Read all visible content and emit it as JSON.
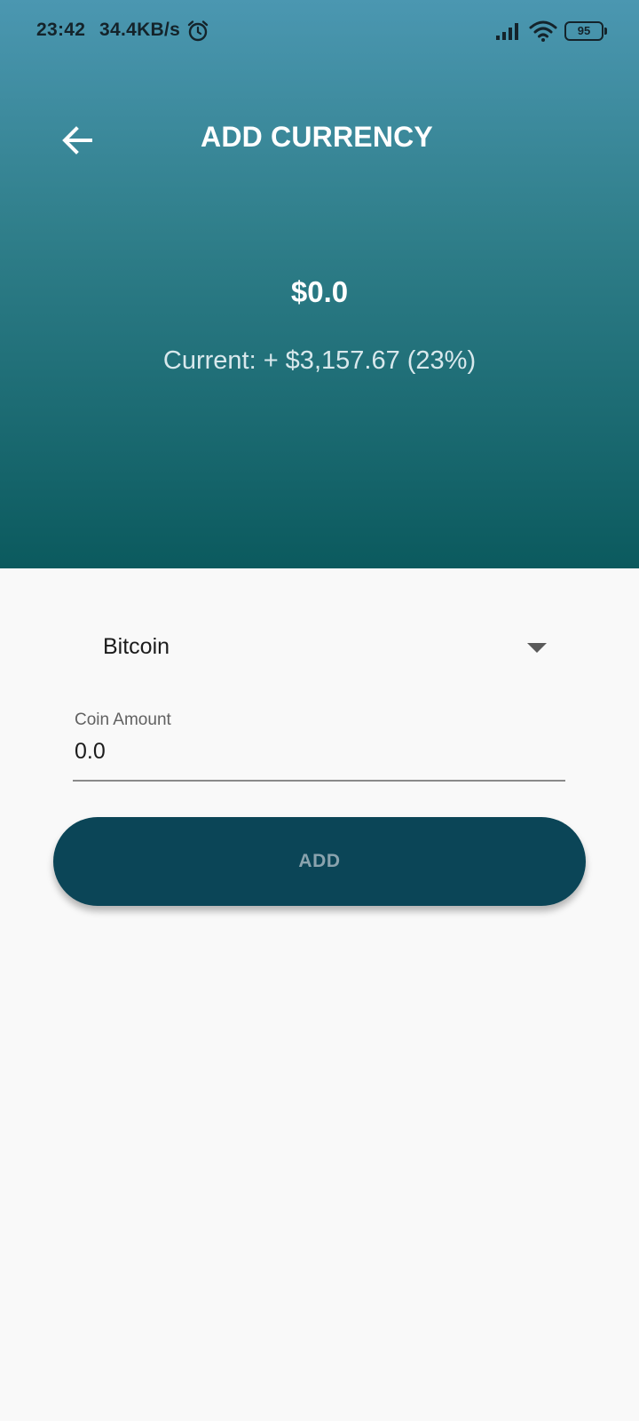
{
  "status_bar": {
    "time": "23:42",
    "network_speed": "34.4KB/s",
    "battery_level": "95",
    "icons": [
      "alarm-icon",
      "signal-icon",
      "wifi-icon",
      "battery-icon"
    ]
  },
  "header": {
    "title": "ADD CURRENCY",
    "back_icon": "arrow-left-icon",
    "total_value": "$0.0",
    "current_line": "Current: + $3,157.67 (23%)",
    "gradient_colors": [
      "#4b97b1",
      "#307f8b",
      "#0b5a5e"
    ]
  },
  "form": {
    "currency_select": {
      "selected": "Bitcoin",
      "icon": "dropdown-arrow-icon"
    },
    "coin_amount": {
      "label": "Coin Amount",
      "value": "0.0"
    },
    "add_button_label": "ADD",
    "button_color": "#0b4557"
  }
}
